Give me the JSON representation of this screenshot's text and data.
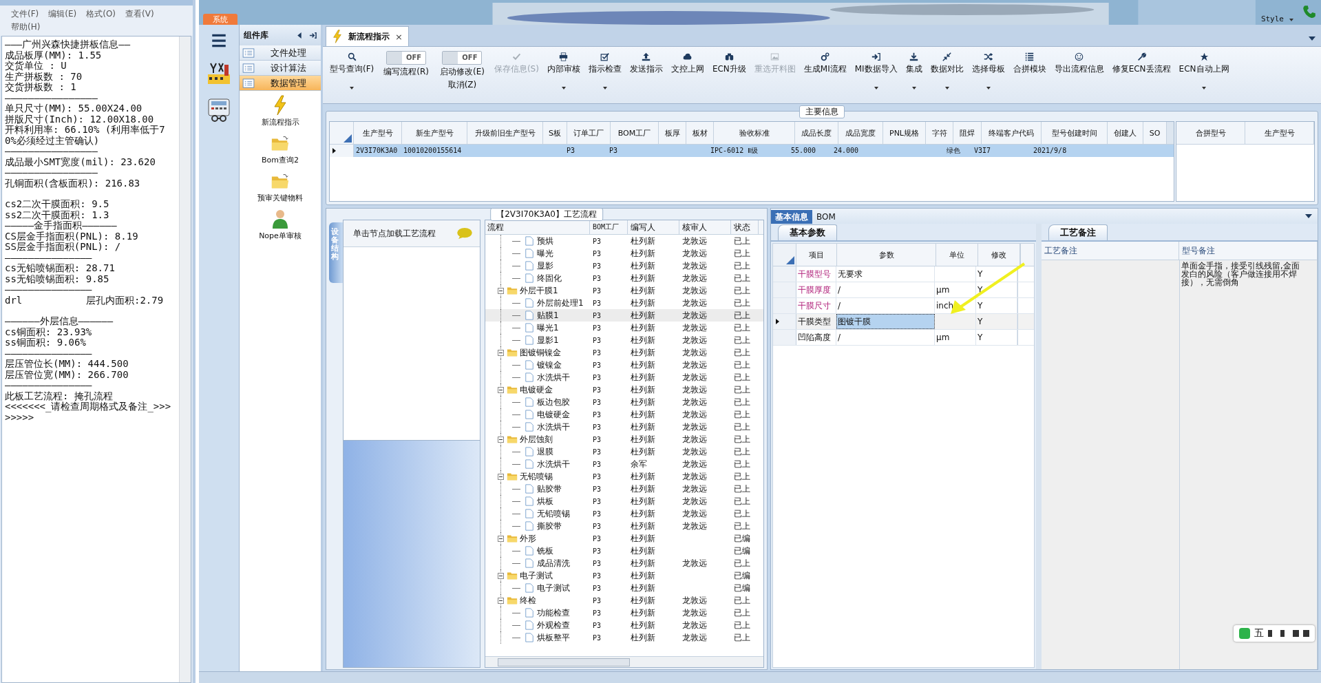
{
  "notepad": {
    "menu": [
      "文件(F)",
      "编辑(E)",
      "格式(O)",
      "查看(V)",
      "帮助(H)"
    ],
    "blocks": [
      [
        "———广州兴森快捷拼板信息——",
        "成品板厚(MM): 1.55",
        "交货单位 : U",
        "生产拼板数 : 70",
        "交货拼板数 : 1",
        "————————————————",
        "单只尺寸(MM): 55.00X24.00",
        "拼版尺寸(Inch): 12.00X18.00",
        "开料利用率: 66.10% (利用率低于70%必须经过主管确认)",
        "————————————————",
        "成品最小SMT宽度(mil): 23.620",
        "————————————————",
        "孔铜面积(含板面积): 216.83"
      ],
      [
        "cs2二次干膜面积: 9.5",
        "ss2二次干膜面积: 1.3",
        "—————金手指面积——————",
        "CS层金手指面积(PNL): 8.19",
        "SS层金手指面积(PNL): /",
        "———————————————",
        "cs无铅喷锡面积: 28.71",
        "ss无铅喷锡面积: 9.85",
        "———————————————",
        "drl           层孔内面积:2.79"
      ],
      [
        "——————外层信息——————",
        "cs铜面积: 23.93%",
        "ss铜面积: 9.06%",
        "———————————————",
        "层压管位长(MM): 444.500",
        "层压管位宽(MM): 266.700",
        "———————————————",
        "此板工艺流程: 掩孔流程",
        "<<<<<<<_请检查周期格式及备注_>>>>>>>>"
      ]
    ]
  },
  "app": {
    "system_tab": "系统",
    "style_menu": "Style"
  },
  "nav": {
    "title": "组件库",
    "groups": [
      {
        "label": "文件处理",
        "selected": false
      },
      {
        "label": "设计算法",
        "selected": false
      },
      {
        "label": "数据管理",
        "selected": true
      }
    ],
    "items": [
      {
        "label": "新流程指示"
      },
      {
        "label": "Bom查询2"
      },
      {
        "label": "预审关键物料"
      },
      {
        "label": "Nope单审核"
      }
    ]
  },
  "doc_tab": {
    "label": "新流程指示",
    "close": "×"
  },
  "ribbon": [
    {
      "kind": "button",
      "label": "型号查询(F)",
      "dropdown": true,
      "disabled": false
    },
    {
      "kind": "toggle",
      "label": "编写流程(R)",
      "state": "OFF",
      "on": false
    },
    {
      "kind": "toggle",
      "label": "启动修改(E)",
      "sub": "取消(Z)",
      "state": "OFF",
      "on": false
    },
    {
      "kind": "button",
      "label": "保存信息(S)",
      "dropdown": false,
      "disabled": true
    },
    {
      "kind": "button",
      "label": "内部审核",
      "dropdown": true,
      "disabled": false
    },
    {
      "kind": "button",
      "label": "指示检查",
      "dropdown": true,
      "disabled": false
    },
    {
      "kind": "button",
      "label": "发送指示",
      "dropdown": false,
      "disabled": false
    },
    {
      "kind": "button",
      "label": "文控上网",
      "dropdown": false,
      "disabled": false
    },
    {
      "kind": "button",
      "label": "ECN升级",
      "dropdown": false,
      "disabled": false
    },
    {
      "kind": "button",
      "label": "重选开料图",
      "dropdown": false,
      "disabled": true
    },
    {
      "kind": "button",
      "label": "生成MI流程",
      "dropdown": false,
      "disabled": false
    },
    {
      "kind": "button",
      "label": "MI数据导入",
      "dropdown": true,
      "disabled": false
    },
    {
      "kind": "button",
      "label": "集成",
      "dropdown": true,
      "disabled": false
    },
    {
      "kind": "button",
      "label": "数据对比",
      "dropdown": true,
      "disabled": false
    },
    {
      "kind": "button",
      "label": "选择母板",
      "dropdown": true,
      "disabled": false
    },
    {
      "kind": "button",
      "label": "合拼模块",
      "dropdown": false,
      "disabled": false
    },
    {
      "kind": "button",
      "label": "导出流程信息",
      "dropdown": false,
      "disabled": false
    },
    {
      "kind": "button",
      "label": "修复ECN丢流程",
      "dropdown": false,
      "disabled": false
    },
    {
      "kind": "button",
      "label": "ECN自动上网",
      "dropdown": true,
      "disabled": false
    }
  ],
  "main_info": {
    "title": "主要信息",
    "columns": [
      "生产型号",
      "新生产型号",
      "升级前旧生产型号",
      "S板",
      "订单工厂",
      "BOM工厂",
      "板厚",
      "板材",
      "验收标准",
      "成品长度",
      "成品宽度",
      "PNL规格",
      "字符",
      "阻焊",
      "终端客户代码",
      "型号创建时间",
      "创建人",
      "SO"
    ],
    "rows": [
      {
        "selected": true,
        "cells": [
          "2V3I70K3A0",
          "10010200155614",
          null,
          null,
          "P3",
          "P3",
          null,
          null,
          "IPC-6012 Ⅱ级",
          "55.000",
          "24.000",
          null,
          null,
          "绿色",
          "V3I7",
          "2021/9/8",
          null,
          null
        ]
      }
    ],
    "side_columns": [
      "合拼型号",
      "生产型号"
    ]
  },
  "flow": {
    "title": "【2V3I70K3A0】工艺流程",
    "side_tab": "设备结构",
    "hint": "单击节点加载工艺流程",
    "columns": [
      "流程",
      "BOM工厂",
      "编写人",
      "核审人",
      "状态"
    ],
    "tree": [
      {
        "children": [
          {
            "name": "预烘",
            "bom": "P3",
            "writer": "杜列新",
            "reviewer": "龙敦远",
            "status": "已上",
            "selected": false
          },
          {
            "name": "曝光",
            "bom": "P3",
            "writer": "杜列新",
            "reviewer": "龙敦远",
            "status": "已上",
            "selected": false
          },
          {
            "name": "显影",
            "bom": "P3",
            "writer": "杜列新",
            "reviewer": "龙敦远",
            "status": "已上",
            "selected": false
          },
          {
            "name": "终固化",
            "bom": "P3",
            "writer": "杜列新",
            "reviewer": "龙敦远",
            "status": "已上",
            "selected": false
          }
        ]
      },
      {
        "name": "外层干膜1",
        "bom": "P3",
        "writer": "杜列新",
        "reviewer": "龙敦远",
        "status": "已上",
        "selected": false,
        "children": [
          {
            "name": "外层前处理1",
            "bom": "P3",
            "writer": "杜列新",
            "reviewer": "龙敦远",
            "status": "已上",
            "selected": false
          },
          {
            "name": "贴膜1",
            "bom": "P3",
            "writer": "杜列新",
            "reviewer": "龙敦远",
            "status": "已上",
            "selected": true
          },
          {
            "name": "曝光1",
            "bom": "P3",
            "writer": "杜列新",
            "reviewer": "龙敦远",
            "status": "已上",
            "selected": false
          },
          {
            "name": "显影1",
            "bom": "P3",
            "writer": "杜列新",
            "reviewer": "龙敦远",
            "status": "已上",
            "selected": false
          }
        ]
      },
      {
        "name": "图镀铜镍金",
        "bom": "P3",
        "writer": "杜列新",
        "reviewer": "龙敦远",
        "status": "已上",
        "selected": false,
        "children": [
          {
            "name": "镀镍金",
            "bom": "P3",
            "writer": "杜列新",
            "reviewer": "龙敦远",
            "status": "已上",
            "selected": false
          },
          {
            "name": "水洗烘干",
            "bom": "P3",
            "writer": "杜列新",
            "reviewer": "龙敦远",
            "status": "已上",
            "selected": false
          }
        ]
      },
      {
        "name": "电镀硬金",
        "bom": "P3",
        "writer": "杜列新",
        "reviewer": "龙敦远",
        "status": "已上",
        "selected": false,
        "children": [
          {
            "name": "板边包胶",
            "bom": "P3",
            "writer": "杜列新",
            "reviewer": "龙敦远",
            "status": "已上",
            "selected": false
          },
          {
            "name": "电镀硬金",
            "bom": "P3",
            "writer": "杜列新",
            "reviewer": "龙敦远",
            "status": "已上",
            "selected": false
          },
          {
            "name": "水洗烘干",
            "bom": "P3",
            "writer": "杜列新",
            "reviewer": "龙敦远",
            "status": "已上",
            "selected": false
          }
        ]
      },
      {
        "name": "外层蚀刻",
        "bom": "P3",
        "writer": "杜列新",
        "reviewer": "龙敦远",
        "status": "已上",
        "selected": false,
        "children": [
          {
            "name": "退膜",
            "bom": "P3",
            "writer": "杜列新",
            "reviewer": "龙敦远",
            "status": "已上",
            "selected": false
          },
          {
            "name": "水洗烘干",
            "bom": "P3",
            "writer": "余军",
            "reviewer": "龙敦远",
            "status": "已上",
            "selected": false
          }
        ]
      },
      {
        "name": "无铅喷锡",
        "bom": "P3",
        "writer": "杜列新",
        "reviewer": "龙敦远",
        "status": "已上",
        "selected": false,
        "children": [
          {
            "name": "贴胶带",
            "bom": "P3",
            "writer": "杜列新",
            "reviewer": "龙敦远",
            "status": "已上",
            "selected": false
          },
          {
            "name": "烘板",
            "bom": "P3",
            "writer": "杜列新",
            "reviewer": "龙敦远",
            "status": "已上",
            "selected": false
          },
          {
            "name": "无铅喷锡",
            "bom": "P3",
            "writer": "杜列新",
            "reviewer": "龙敦远",
            "status": "已上",
            "selected": false
          },
          {
            "name": "撕胶带",
            "bom": "P3",
            "writer": "杜列新",
            "reviewer": "龙敦远",
            "status": "已上",
            "selected": false
          }
        ]
      },
      {
        "name": "外形",
        "bom": "P3",
        "writer": "杜列新",
        "status": "已编",
        "selected": false,
        "children": [
          {
            "name": "铣板",
            "bom": "P3",
            "writer": "杜列新",
            "status": "已编",
            "selected": false
          },
          {
            "name": "成品清洗",
            "bom": "P3",
            "writer": "杜列新",
            "reviewer": "龙敦远",
            "status": "已上",
            "selected": false
          }
        ]
      },
      {
        "name": "电子测试",
        "bom": "P3",
        "writer": "杜列新",
        "status": "已编",
        "selected": false,
        "children": [
          {
            "name": "电子测试",
            "bom": "P3",
            "writer": "杜列新",
            "status": "已编",
            "selected": false
          }
        ]
      },
      {
        "name": "终检",
        "bom": "P3",
        "writer": "杜列新",
        "reviewer": "龙敦远",
        "status": "已上",
        "selected": false,
        "children": [
          {
            "name": "功能检查",
            "bom": "P3",
            "writer": "杜列新",
            "reviewer": "龙敦远",
            "status": "已上",
            "selected": false
          },
          {
            "name": "外观检查",
            "bom": "P3",
            "writer": "杜列新",
            "reviewer": "龙敦远",
            "status": "已上",
            "selected": false
          },
          {
            "name": "烘板整平",
            "bom": "P3",
            "writer": "杜列新",
            "reviewer": "龙敦远",
            "status": "已上",
            "selected": false
          }
        ]
      }
    ]
  },
  "info_tabs": [
    {
      "label": "基本信息",
      "selected": true
    },
    {
      "label": "BOM",
      "selected": false
    }
  ],
  "params": {
    "title": "基本参数",
    "columns": [
      "项目",
      "参数",
      "单位",
      "修改"
    ],
    "rows": [
      {
        "item": "干膜型号",
        "value": "无要求",
        "unit": null,
        "edit": "Y",
        "required": true,
        "selected": false
      },
      {
        "item": "干膜厚度",
        "value": "/",
        "unit": "μm",
        "edit": "Y",
        "required": true,
        "selected": false
      },
      {
        "item": "干膜尺寸",
        "value": "/",
        "unit": "inch",
        "edit": "Y",
        "required": true,
        "selected": false
      },
      {
        "item": "干膜类型",
        "value": "图镀干膜",
        "unit": null,
        "edit": "Y",
        "required": false,
        "selected": true
      },
      {
        "item": "凹陷高度",
        "value": "/",
        "unit": "μm",
        "edit": "Y",
        "required": false,
        "selected": false
      }
    ]
  },
  "remarks": {
    "title": "工艺备注",
    "columns": [
      "工艺备注",
      "型号备注"
    ],
    "model_note": "单面金手指，接受引线残留,金面发白的风险（客户做连接用不焊接），无需倒角"
  },
  "ime": {
    "mode": "五"
  }
}
